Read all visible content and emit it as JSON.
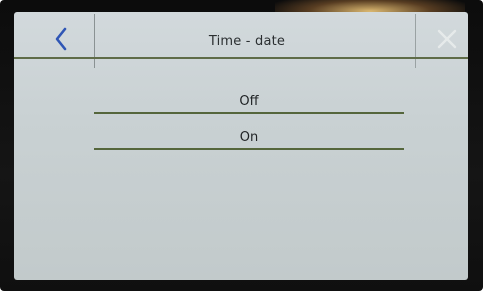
{
  "header": {
    "title": "Time - date",
    "back_icon": "chevron-left-icon",
    "close_icon": "close-icon"
  },
  "options": [
    {
      "label": "Off"
    },
    {
      "label": "On"
    }
  ],
  "colors": {
    "screen_bg": "#c9d1d3",
    "accent_line": "#55663c",
    "back_icon": "#2f56b5",
    "close_icon": "#e6eaea"
  }
}
